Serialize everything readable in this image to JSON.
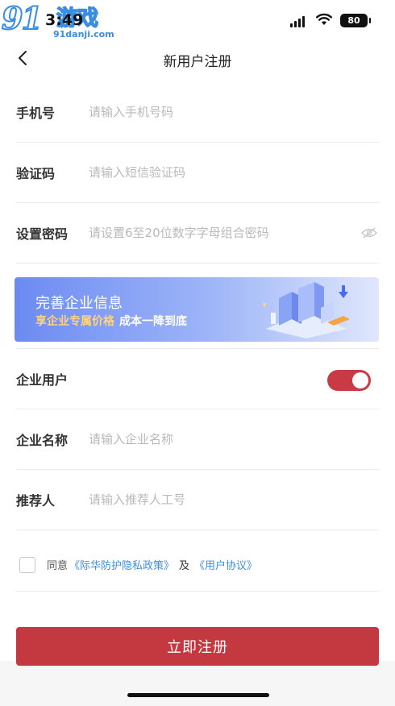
{
  "status": {
    "time": "3:49",
    "battery": "80",
    "watermark_logo": "91",
    "watermark_game": "游戏",
    "watermark_url": "91danji.com"
  },
  "nav": {
    "title": "新用户注册",
    "back_icon": "chevron-left-icon"
  },
  "form": {
    "phone": {
      "label": "手机号",
      "placeholder": "请输入手机号码"
    },
    "code": {
      "label": "验证码",
      "placeholder": "请输入短信验证码"
    },
    "password": {
      "label": "设置密码",
      "placeholder": "请设置6至20位数字字母组合密码",
      "icon": "eye-hidden-icon"
    },
    "enterprise_user": {
      "label": "企业用户",
      "enabled": true
    },
    "company": {
      "label": "企业名称",
      "placeholder": "请输入企业名称"
    },
    "referrer": {
      "label": "推荐人",
      "placeholder": "请输入推荐人工号"
    }
  },
  "banner": {
    "title": "完善企业信息",
    "highlight": "享企业专属价格",
    "rest": "成本一降到底"
  },
  "agreement": {
    "prefix": "同意",
    "privacy_link": "《际华防护隐私政策》",
    "and": "及",
    "user_link": "《用户协议》",
    "checked": false
  },
  "submit": {
    "label": "立即注册"
  },
  "colors": {
    "accent": "#c43940",
    "link": "#3b8fe0",
    "banner_highlight": "#ffd37a"
  }
}
